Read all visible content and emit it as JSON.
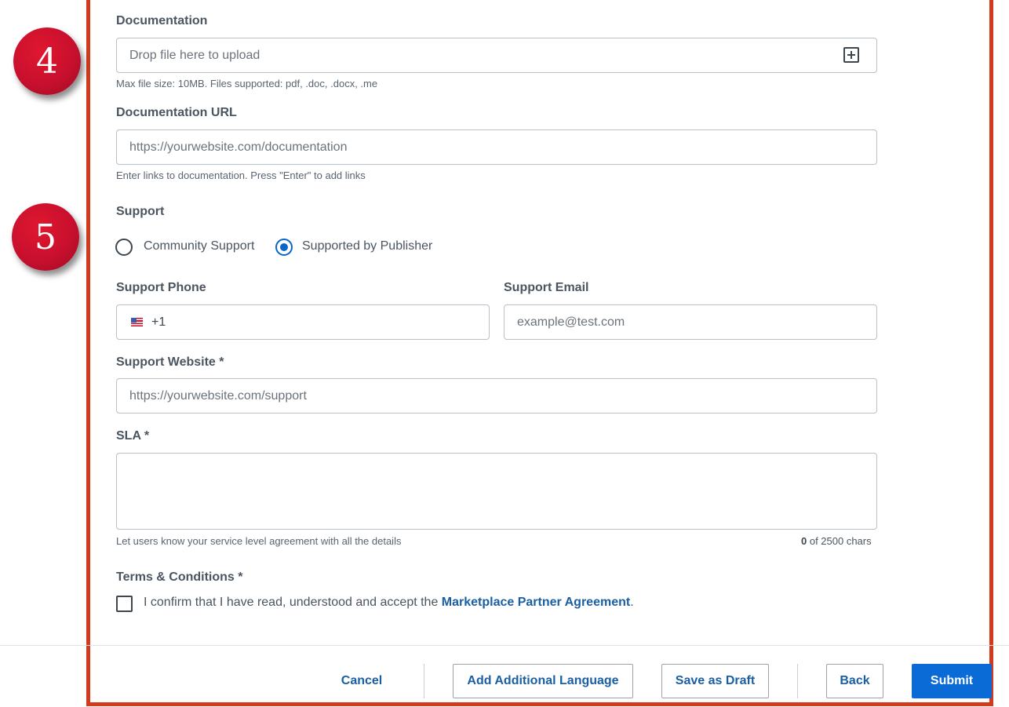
{
  "markers": [
    "4",
    "5"
  ],
  "documentation": {
    "label": "Documentation",
    "placeholder": "Drop file here to upload",
    "helper": "Max file size: 10MB. Files supported: pdf, .doc, .docx, .me"
  },
  "documentation_url": {
    "label": "Documentation URL",
    "placeholder": "https://yourwebsite.com/documentation",
    "helper": "Enter links to documentation. Press \"Enter\" to add links"
  },
  "support": {
    "label": "Support",
    "options": [
      {
        "label": "Community Support",
        "selected": false
      },
      {
        "label": "Supported by Publisher",
        "selected": true
      }
    ]
  },
  "support_phone": {
    "label": "Support Phone",
    "value": "+1"
  },
  "support_email": {
    "label": "Support Email",
    "placeholder": "example@test.com"
  },
  "support_website": {
    "label": "Support Website *",
    "placeholder": "https://yourwebsite.com/support"
  },
  "sla": {
    "label": "SLA *",
    "helper": "Let users know your service level agreement with all the details",
    "count": "0",
    "count_suffix": " of 2500 chars"
  },
  "terms": {
    "label": "Terms & Conditions *",
    "text": "I confirm that I have read, understood and accept the ",
    "link": "Marketplace Partner Agreement",
    "suffix": "."
  },
  "footer": {
    "cancel": "Cancel",
    "add_language": "Add Additional Language",
    "save_draft": "Save as Draft",
    "back": "Back",
    "submit": "Submit"
  },
  "colors": {
    "accent": "#0a6bd6",
    "frame": "#d13a1a",
    "marker": "#c8102e"
  }
}
